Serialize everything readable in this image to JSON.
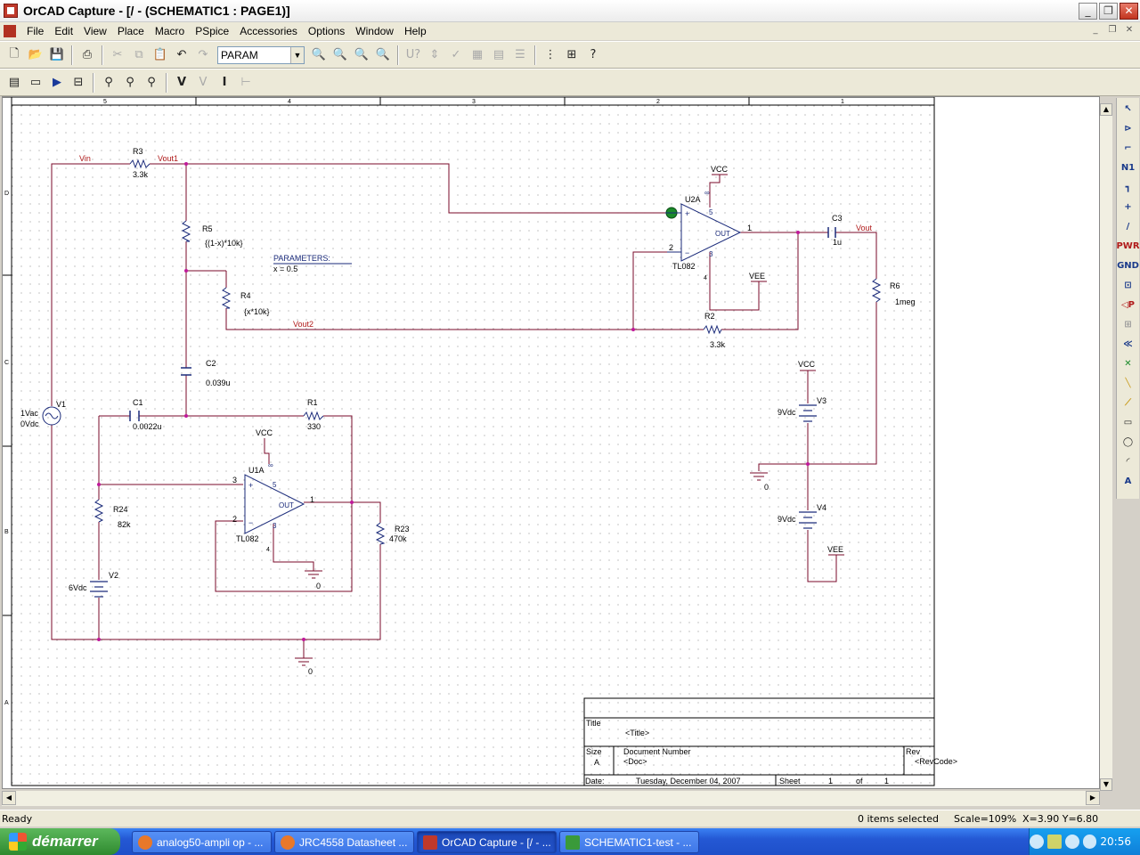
{
  "window": {
    "title": "OrCAD Capture - [/ - (SCHEMATIC1 : PAGE1)]"
  },
  "menu": [
    "File",
    "Edit",
    "View",
    "Place",
    "Macro",
    "PSpice",
    "Accessories",
    "Options",
    "Window",
    "Help"
  ],
  "toolbar": {
    "part_combo": "PARAM"
  },
  "schematic": {
    "border_columns": [
      "5",
      "4",
      "3",
      "2",
      "1"
    ],
    "border_rows": [
      "D",
      "C",
      "B",
      "A"
    ],
    "nets": {
      "vin": "Vin",
      "vout1": "Vout1",
      "vout2": "Vout2",
      "vout": "Vout"
    },
    "parts": {
      "r3": {
        "ref": "R3",
        "value": "3.3k"
      },
      "r5": {
        "ref": "R5",
        "value": "{(1-x)*10k}"
      },
      "r4": {
        "ref": "R4",
        "value": "{x*10k}"
      },
      "r2": {
        "ref": "R2",
        "value": "3.3k"
      },
      "r6": {
        "ref": "R6",
        "value": "1meg"
      },
      "r1": {
        "ref": "R1",
        "value": "330"
      },
      "r24": {
        "ref": "R24",
        "value": "82k"
      },
      "r23": {
        "ref": "R23",
        "value": "470k"
      },
      "c1": {
        "ref": "C1",
        "value": "0.0022u"
      },
      "c2": {
        "ref": "C2",
        "value": "0.039u"
      },
      "c3": {
        "ref": "C3",
        "value": "1u"
      },
      "v1": {
        "ref": "V1",
        "ac": "1Vac",
        "dc": "0Vdc"
      },
      "v2": {
        "ref": "V2",
        "value": "6Vdc"
      },
      "v3": {
        "ref": "V3",
        "value": "9Vdc"
      },
      "v4": {
        "ref": "V4",
        "value": "9Vdc"
      },
      "u2a": {
        "ref": "U2A",
        "model": "TL082",
        "out": "OUT",
        "pin_out": "1",
        "pin_inv": "2",
        "pin_v": "4"
      },
      "u1a": {
        "ref": "U1A",
        "model": "TL082",
        "out": "OUT",
        "pin_out": "1",
        "pin_inv": "2",
        "pin_noninv": "3",
        "pin_v": "4"
      }
    },
    "power": {
      "vcc": "VCC",
      "vee": "VEE",
      "gnd": "0"
    },
    "params": {
      "title": "PARAMETERS:",
      "value": "x = 0.5"
    },
    "title_block": {
      "title_label": "Title",
      "title_value": "<Title>",
      "size_label": "Size",
      "size_value": "A",
      "docnum_label": "Document Number",
      "docnum_value": "<Doc>",
      "rev_label": "Rev",
      "rev_value": "<RevCode>",
      "date_label": "Date:",
      "date_value": "Tuesday, December 04, 2007",
      "sheet_label": "Sheet",
      "sheet_num": "1",
      "of_label": "of",
      "sheet_total": "1"
    }
  },
  "status": {
    "ready": "Ready",
    "selected": "0 items selected",
    "scale": "Scale=109%",
    "coords": "X=3.90  Y=6.80"
  },
  "taskbar": {
    "start": "démarrer",
    "tasks": [
      "analog50-ampli op - ...",
      "JRC4558 Datasheet ...",
      "OrCAD Capture - [/ - ...",
      "SCHEMATIC1-test - ..."
    ],
    "clock": "20:56"
  },
  "colors": {
    "wire": "#7a0a2a",
    "part": "#1a2a7a",
    "net_label": "#b01a1a"
  }
}
